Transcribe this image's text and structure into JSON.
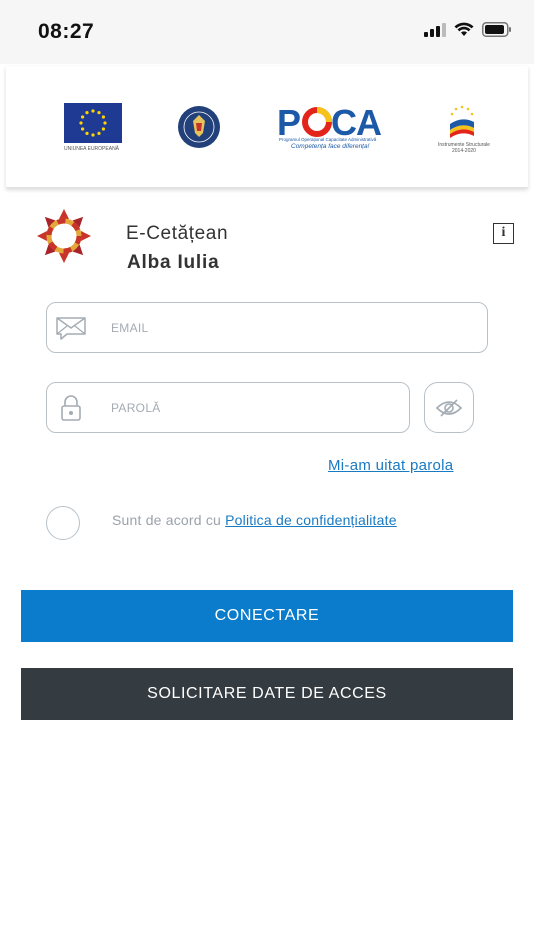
{
  "status": {
    "time": "08:27"
  },
  "sponsors": {
    "eu_caption": "UNIUNEA EUROPEANĂ",
    "poca_name": "POCA",
    "poca_line1": "Programul Operațional Capacitate Administrativă",
    "poca_tagline": "Competența face diferența!",
    "si_caption1": "Instrumente Structurale",
    "si_caption2": "2014-2020"
  },
  "app": {
    "title": "E-Cetățean",
    "subtitle": "Alba Iulia"
  },
  "form": {
    "email_placeholder": "EMAIL",
    "password_placeholder": "PAROLĂ",
    "forgot_password": "Mi-am uitat parola",
    "agree_prefix": "Sunt de acord cu ",
    "agree_link": "Politica de confidențialitate"
  },
  "buttons": {
    "connect": "CONECTARE",
    "request_access": "SOLICITARE DATE DE ACCES"
  },
  "colors": {
    "primary": "#0a7ccb",
    "dark": "#343c42",
    "link": "#1a7ac2",
    "border": "#b9c1c8"
  }
}
